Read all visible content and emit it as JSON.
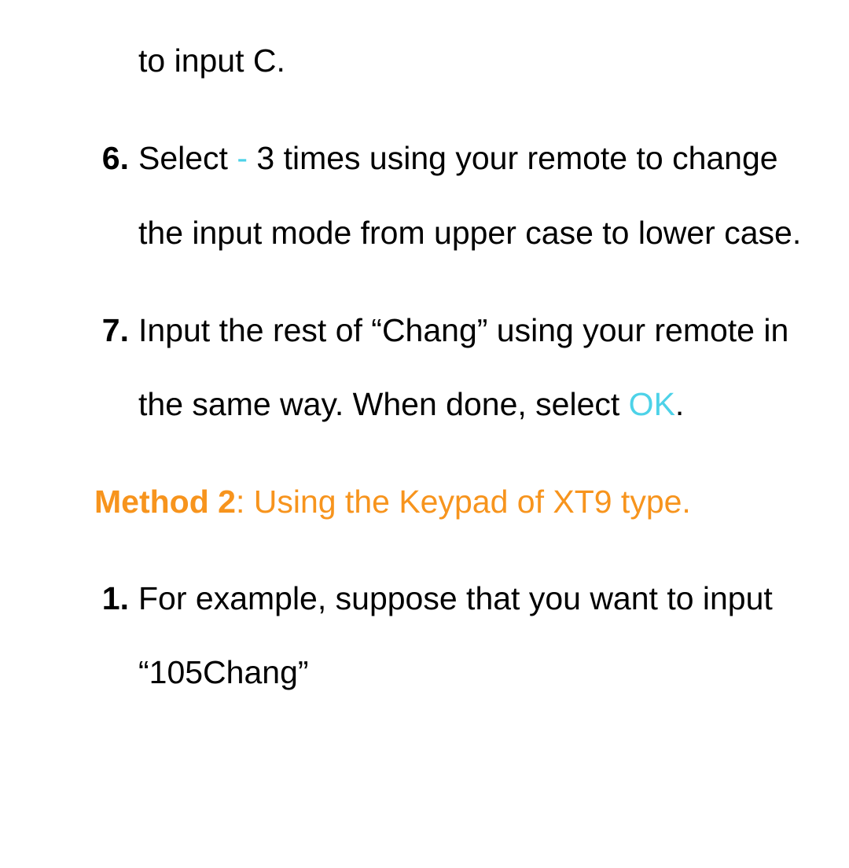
{
  "items": [
    {
      "type": "continuation",
      "text": "to input C."
    },
    {
      "type": "numbered",
      "number": "6.",
      "text_before": "Select ",
      "highlight": "-",
      "text_after": " 3 times using your remote to change the input mode from upper case to lower case."
    },
    {
      "type": "numbered",
      "number": "7.",
      "text_before": "Input the rest of “Chang” using your remote in the same way. When done, select ",
      "highlight": "OK",
      "text_after": "."
    }
  ],
  "method": {
    "label": "Method 2",
    "title": ": Using the Keypad of XT9 type."
  },
  "sublist": [
    {
      "number": "1.",
      "text": "For example, suppose that you want to input “105Chang”"
    }
  ]
}
